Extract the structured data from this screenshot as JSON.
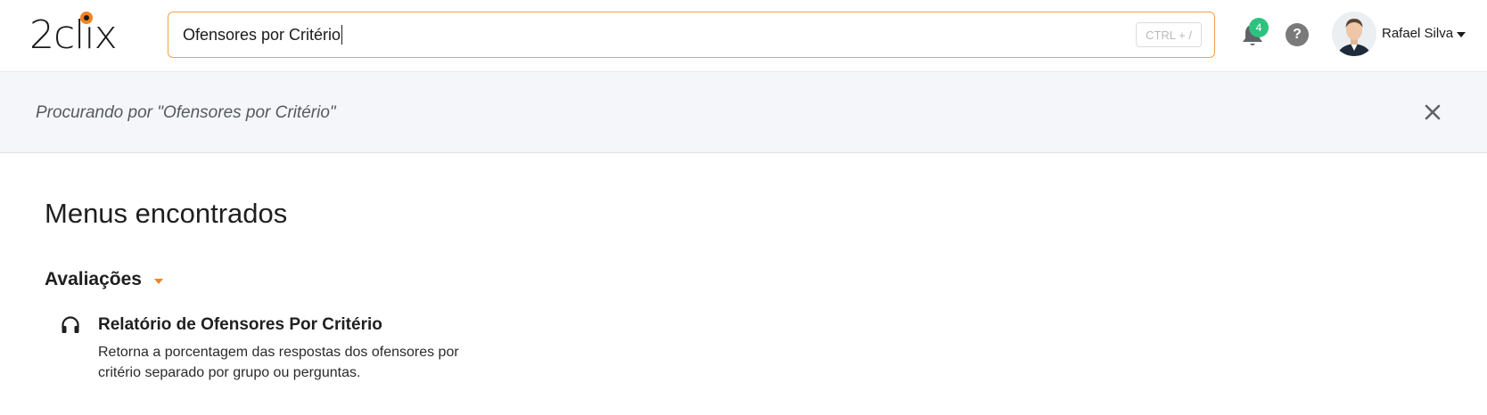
{
  "header": {
    "logo_text": "2clix",
    "search": {
      "value": "Ofensores por Critério",
      "shortcut_hint": "CTRL + /"
    },
    "notifications": {
      "count": "4"
    },
    "help_label": "?",
    "user": {
      "name": "Rafael Silva"
    }
  },
  "banner": {
    "text": "Procurando por \"Ofensores por Critério\""
  },
  "results": {
    "title": "Menus encontrados",
    "groups": [
      {
        "title": "Avaliações",
        "items": [
          {
            "icon": "headphones-icon",
            "title": "Relatório de Ofensores Por Critério",
            "description": "Retorna a porcentagem das respostas dos ofensores por critério separado por grupo ou perguntas."
          }
        ]
      }
    ]
  },
  "colors": {
    "accent": "#f5821f",
    "badge": "#2ec27e",
    "banner_bg": "#f4f6f9"
  }
}
